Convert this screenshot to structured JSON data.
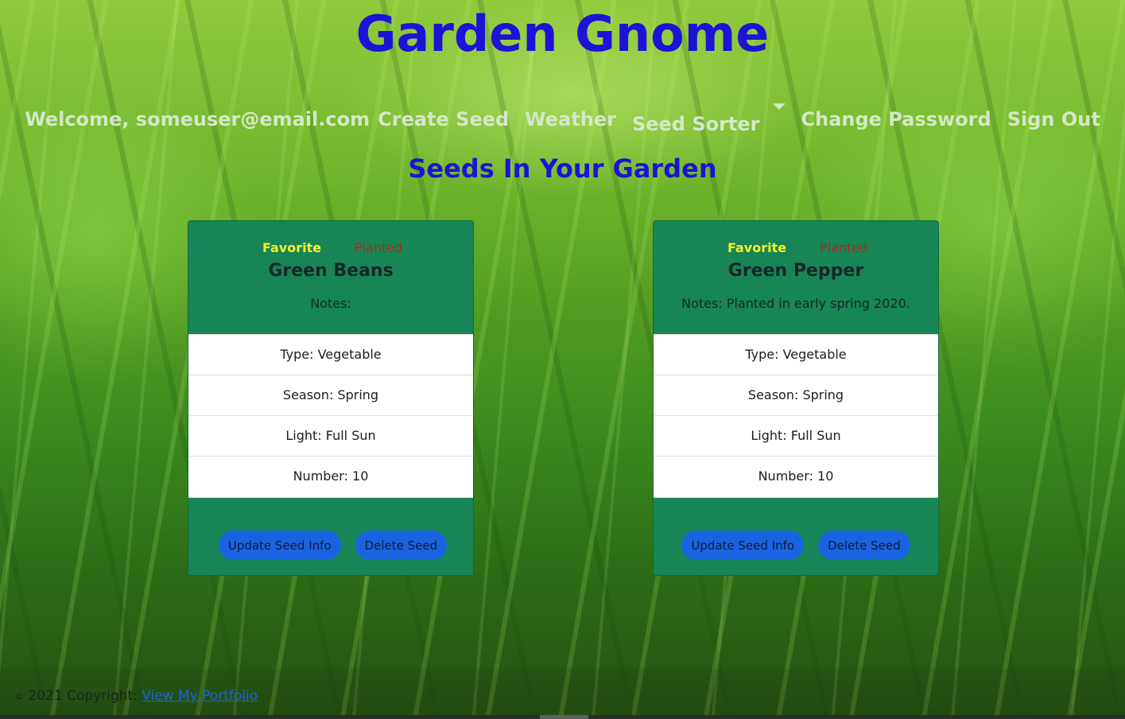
{
  "app": {
    "title": "Garden Gnome"
  },
  "nav": {
    "welcome": "Welcome, someuser@email.com",
    "items": [
      {
        "label": "Create Seed"
      },
      {
        "label": "Weather"
      },
      {
        "label": "Seed Sorter"
      },
      {
        "label": "Change Password"
      },
      {
        "label": "Sign Out"
      }
    ]
  },
  "main": {
    "heading": "Seeds In Your Garden"
  },
  "seeds": [
    {
      "favorite": "Favorite",
      "planted": "Planted",
      "name": "Green Beans",
      "notes": "Notes:",
      "type": "Type: Vegetable",
      "season": "Season: Spring",
      "light": "Light: Full Sun",
      "number": "Number: 10",
      "update_label": "Update Seed Info",
      "delete_label": "Delete Seed"
    },
    {
      "favorite": "Favorite",
      "planted": "Planted",
      "name": "Green Pepper",
      "notes": "Notes: Planted in early spring 2020.",
      "type": "Type: Vegetable",
      "season": "Season: Spring",
      "light": "Light: Full Sun",
      "number": "Number: 10",
      "update_label": "Update Seed Info",
      "delete_label": "Delete Seed"
    }
  ],
  "footer": {
    "copyright_symbol": "©",
    "text": "2021 Copyright:",
    "link_label": "View My Portfolio"
  },
  "colors": {
    "title": "#1b14d6",
    "nav_text": "#d3e8c7",
    "card_bg": "#178555",
    "favorite": "#f5f12a",
    "planted": "#a82a1f",
    "button_bg": "#1a63e0"
  }
}
